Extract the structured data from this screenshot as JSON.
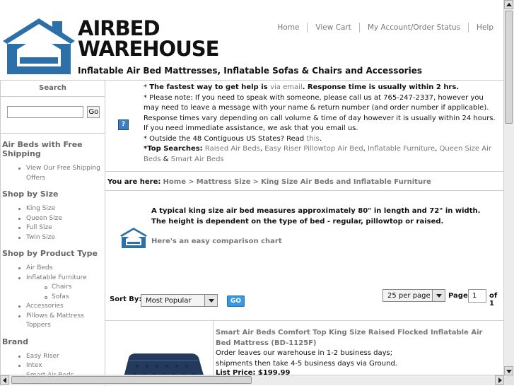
{
  "brand": {
    "line1": "AIRBED",
    "line2": "WAREHOUSE",
    "tagline": "Inflatable Air Bed Mattresses, Inflatable Sofas & Chairs and Accessories",
    "logo_icon": "house-logo-icon",
    "colors": {
      "logo_blue": "#2d6fa8",
      "go_blue": "#3b97e0"
    }
  },
  "topnav": [
    "Home",
    "View Cart",
    "My Account/Order Status",
    "Help"
  ],
  "sidebar": {
    "search_title": "Search",
    "search_button": "Go",
    "search_value": "",
    "sections": [
      {
        "title": "Air Beds with Free Shipping",
        "items": [
          {
            "label": "View Our Free Shipping Offers",
            "sub": false
          }
        ]
      },
      {
        "title": "Shop by Size",
        "items": [
          {
            "label": "King Size",
            "sub": false
          },
          {
            "label": "Queen Size",
            "sub": false
          },
          {
            "label": "Full Size",
            "sub": false
          },
          {
            "label": "Twin Size",
            "sub": false
          }
        ]
      },
      {
        "title": "Shop by Product Type",
        "items": [
          {
            "label": "Air Beds",
            "sub": false
          },
          {
            "label": "Inflatable Furniture",
            "sub": false
          },
          {
            "label": "Chairs",
            "sub": true
          },
          {
            "label": "Sofas",
            "sub": true
          },
          {
            "label": "Accessories",
            "sub": false
          },
          {
            "label": "Pillows & Mattress Toppers",
            "sub": false
          }
        ]
      },
      {
        "title": "Brand",
        "items": [
          {
            "label": "Easy Riser",
            "sub": false
          },
          {
            "label": "Intex",
            "sub": false
          },
          {
            "label": "Smart Air Beds",
            "sub": false
          }
        ]
      }
    ]
  },
  "notice": {
    "l1_a": "* ",
    "l1_b": "The fastest way to get help is ",
    "l1_link": "via email",
    "l1_c": ". Response time is usually within 2 hrs.",
    "l2": "* Please note: If you need to speak with someone, please call us at 765-247-2337, however you may need to leave a message with your name & return number (and order number if applicable). Response times vary depending on call volume & time of day however it is usually within 24 hours. If you need immediate assistance, we ask that you email us.",
    "l3_a": "* Outside the 48 Contiguous US States? Read ",
    "l3_link": "this",
    "l3_b": ".",
    "top_label": "*Top Searches:",
    "top_searches": [
      "Raised Air Beds",
      "Easy Riser Pillowtop Air Bed",
      "Inflatable Furniture",
      "Queen Size Air Beds",
      "Smart Air Beds"
    ],
    "help_icon": "?"
  },
  "breadcrumb": {
    "label": "You are here:",
    "items": [
      "Home",
      "Mattress Size",
      "King Size Air Beds and Inflatable Furniture"
    ],
    "sep": ">"
  },
  "info": {
    "text": "A typical king size air bed measures approximately 80\" in length and 72\" in width. The height is dependent on the type of bed - regular, pillowtop or raised.",
    "link": "Here's an easy comparison chart"
  },
  "sort": {
    "label": "Sort By:",
    "selected": "Most Popular",
    "go": "GO",
    "per_page": "25 per page",
    "page_label": "Page",
    "page_value": "1",
    "of_label": "of 1"
  },
  "product": {
    "title": "Smart Air Beds Comfort Top King Size Raised Flocked Inflatable Air Bed Mattress (BD-1125F)",
    "line1": "Order leaves our warehouse in 1-2 business days;",
    "line2": "shipments then take 4-5 business days via Ground.",
    "price": "List Price: $199.99"
  }
}
